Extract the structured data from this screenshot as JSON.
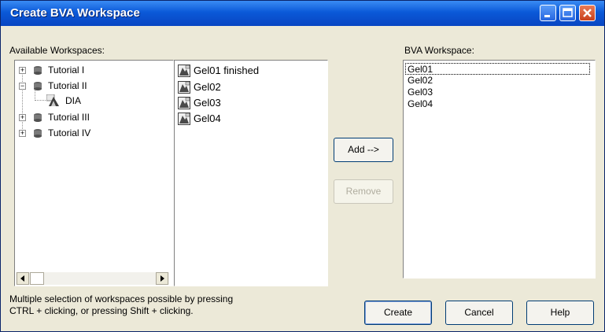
{
  "window": {
    "title": "Create BVA Workspace",
    "controls": {
      "minimize": "minimize-icon",
      "maximize": "maximize-icon",
      "close": "close-icon"
    }
  },
  "available": {
    "label": "Available Workspaces:",
    "tree": [
      {
        "label": "Tutorial I",
        "expanded": false
      },
      {
        "label": "Tutorial II",
        "expanded": true,
        "children": [
          {
            "label": "DIA"
          }
        ]
      },
      {
        "label": "Tutorial III",
        "expanded": false
      },
      {
        "label": "Tutorial IV",
        "expanded": false
      }
    ]
  },
  "workspaces": [
    "Gel01 finished",
    "Gel02",
    "Gel03",
    "Gel04"
  ],
  "actions": {
    "add": "Add -->",
    "remove": "Remove"
  },
  "bva": {
    "label": "BVA Workspace:",
    "items": [
      "Gel01",
      "Gel02",
      "Gel03",
      "Gel04"
    ]
  },
  "hint": {
    "line1": "Multiple selection of workspaces possible by pressing",
    "line2": "CTRL + clicking, or pressing Shift + clicking."
  },
  "buttons": {
    "create": "Create",
    "cancel": "Cancel",
    "help": "Help"
  },
  "colors": {
    "title_bar": "#0b59d8",
    "dialog_bg": "#ece9d8",
    "close_button": "#c9401c",
    "button_border": "#003c74"
  }
}
